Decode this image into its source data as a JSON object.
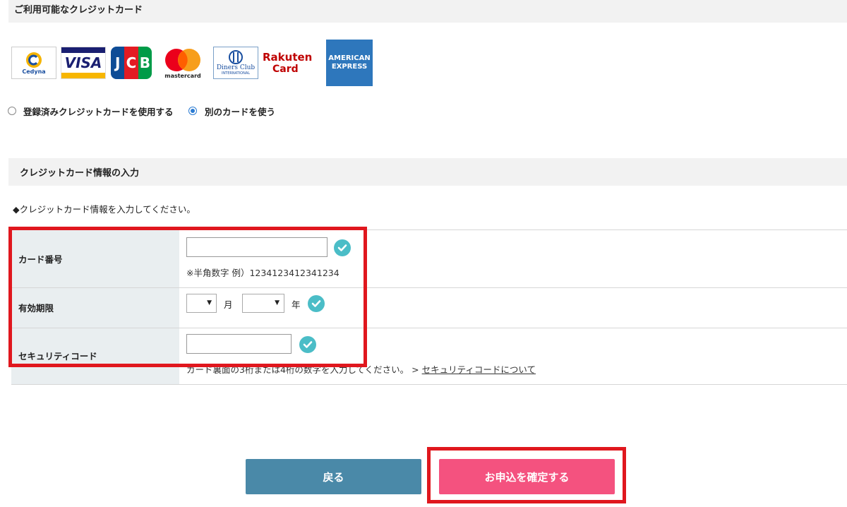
{
  "cards_section": {
    "title": "ご利用可能なクレジットカード",
    "logos": [
      {
        "name": "cedyna",
        "text": "Cedyna"
      },
      {
        "name": "visa",
        "text": "VISA"
      },
      {
        "name": "jcb",
        "text": "JCB"
      },
      {
        "name": "mastercard",
        "text": "mastercard"
      },
      {
        "name": "diners",
        "text": "Diners Club",
        "sub": "INTERNATIONAL"
      },
      {
        "name": "rakuten",
        "text": "Rakuten",
        "sub": "Card"
      },
      {
        "name": "amex",
        "text": "AMERICAN",
        "sub": "EXPRESS"
      }
    ]
  },
  "card_choice": {
    "options": [
      {
        "label": "登録済みクレジットカードを使用する",
        "checked": false
      },
      {
        "label": "別のカードを使う",
        "checked": true
      }
    ]
  },
  "info_section": {
    "title": "クレジットカード情報の入力",
    "note": "◆クレジットカード情報を入力してください。"
  },
  "form": {
    "card_number": {
      "label": "カード番号",
      "value": "",
      "hint": "※半角数字 例）1234123412341234"
    },
    "expiry": {
      "label": "有効期限",
      "month_value": "",
      "month_unit": "月",
      "year_value": "",
      "year_unit": "年"
    },
    "security": {
      "label": "セキュリティコード",
      "value": "",
      "hint": "カード裏面の3桁または4桁の数字を入力してください。 >",
      "link": "セキュリティコードについて"
    }
  },
  "buttons": {
    "back": "戻る",
    "confirm": "お申込を確定する"
  },
  "colors": {
    "highlight": "#e0171e",
    "check": "#4bbdc7",
    "back_button": "#4a89a8",
    "confirm_button": "#f4527f"
  }
}
